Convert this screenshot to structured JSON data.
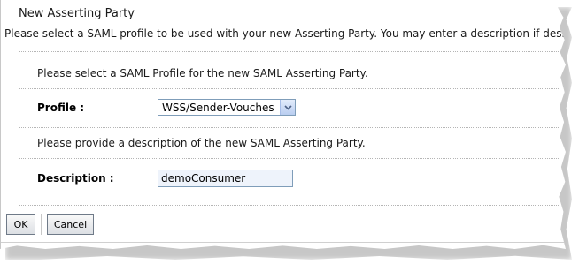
{
  "page": {
    "title": "New Asserting Party",
    "intro": "Please select a SAML profile to be used with your new Asserting Party. You may enter a description if desire"
  },
  "profile_section": {
    "instruction": "Please select a SAML Profile for the new SAML Asserting Party.",
    "label": "Profile :",
    "selected_value": "WSS/Sender-Vouches"
  },
  "description_section": {
    "instruction": "Please provide a description of the new SAML Asserting Party.",
    "label": "Description :",
    "value": "demoConsumer"
  },
  "buttons": {
    "ok": "OK",
    "cancel": "Cancel"
  },
  "icons": {
    "dropdown": "chevron-down-icon"
  }
}
